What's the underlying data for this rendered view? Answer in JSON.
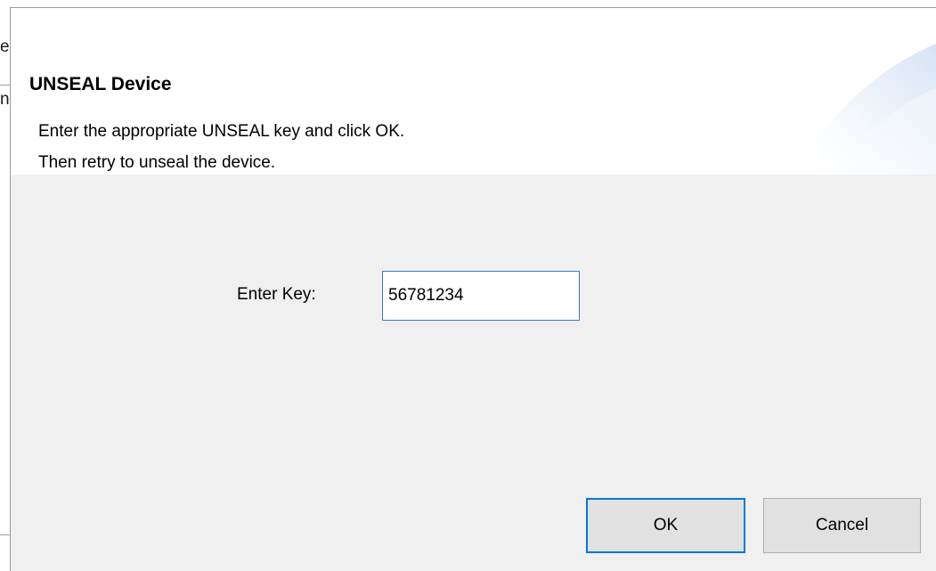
{
  "background_window": {
    "char_top": "e",
    "char_bottom": "n"
  },
  "dialog": {
    "title": "UNSEAL Device",
    "description_line1": "Enter the appropriate UNSEAL key and click OK.",
    "description_line2": "Then retry to unseal the device.",
    "key_label": "Enter Key:",
    "key_value": "56781234",
    "ok_label": "OK",
    "cancel_label": "Cancel"
  },
  "colors": {
    "dialog_background": "#f0f0f0",
    "header_background": "#ffffff",
    "focus_accent": "#0078d7",
    "button_face": "#e1e1e1"
  }
}
